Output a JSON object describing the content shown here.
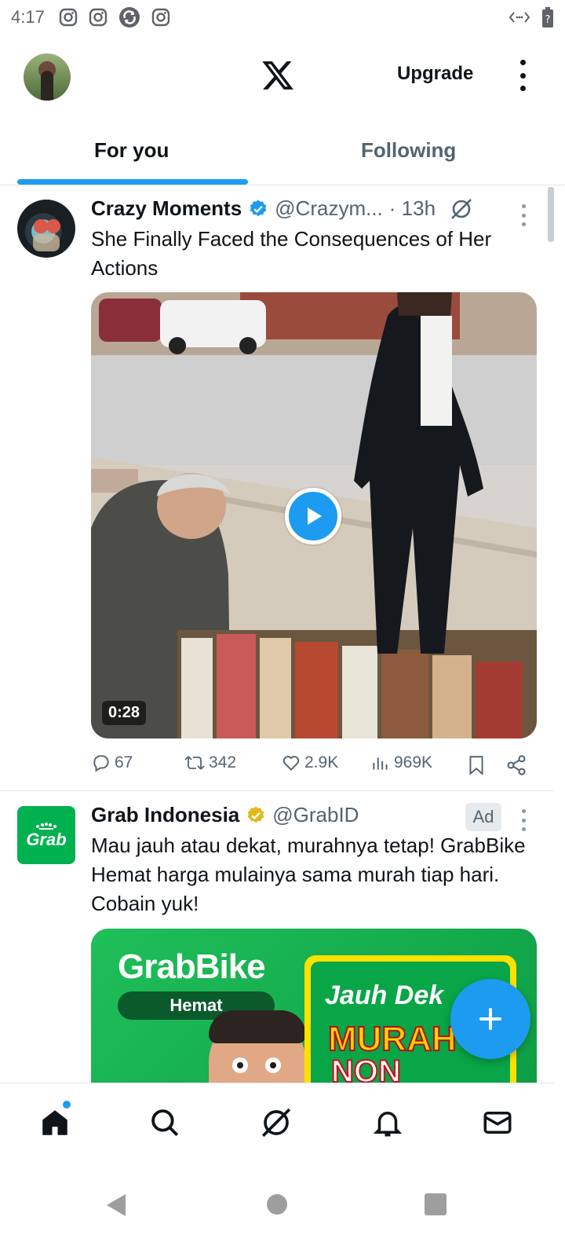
{
  "status_bar": {
    "time": "4:17",
    "notification_icons": [
      "instagram-icon",
      "instagram-icon",
      "sync-app-icon",
      "instagram-icon"
    ],
    "right_icons": [
      "data-saver-icon",
      "battery-icon"
    ]
  },
  "top_bar": {
    "upgrade_label": "Upgrade",
    "logo": "x-logo-icon"
  },
  "tabs": [
    {
      "label": "For you",
      "active": true
    },
    {
      "label": "Following",
      "active": false
    }
  ],
  "posts": [
    {
      "display_name": "Crazy Moments",
      "verified": "blue",
      "handle": "@Crazym...",
      "time": "· 13h",
      "text": "She Finally Faced the Consequences of Her Actions",
      "media": {
        "type": "video",
        "duration": "0:28"
      },
      "stats": {
        "replies": "67",
        "reposts": "342",
        "likes": "2.9K",
        "views": "969K"
      }
    },
    {
      "display_name": "Grab Indonesia",
      "verified": "gold",
      "handle": "@GrabID",
      "ad_label": "Ad",
      "text": "Mau jauh atau dekat, murahnya tetap! GrabBike Hemat harga mulainya sama murah tiap hari. Cobain yuk!",
      "logo_text": "Grab",
      "banner": {
        "brand": "GrabBike",
        "pill": "Hemat",
        "headline": "Jauh Dek",
        "murah": "MURAH",
        "non": "NON"
      }
    }
  ],
  "bottom_nav": [
    "home-icon",
    "search-icon",
    "grok-icon",
    "notifications-icon",
    "messages-icon"
  ],
  "colors": {
    "accent": "#1d9bf0",
    "grab_green": "#00b14f",
    "gold_badge": "#e2b719",
    "text_primary": "#0f1419",
    "text_secondary": "#536471"
  }
}
